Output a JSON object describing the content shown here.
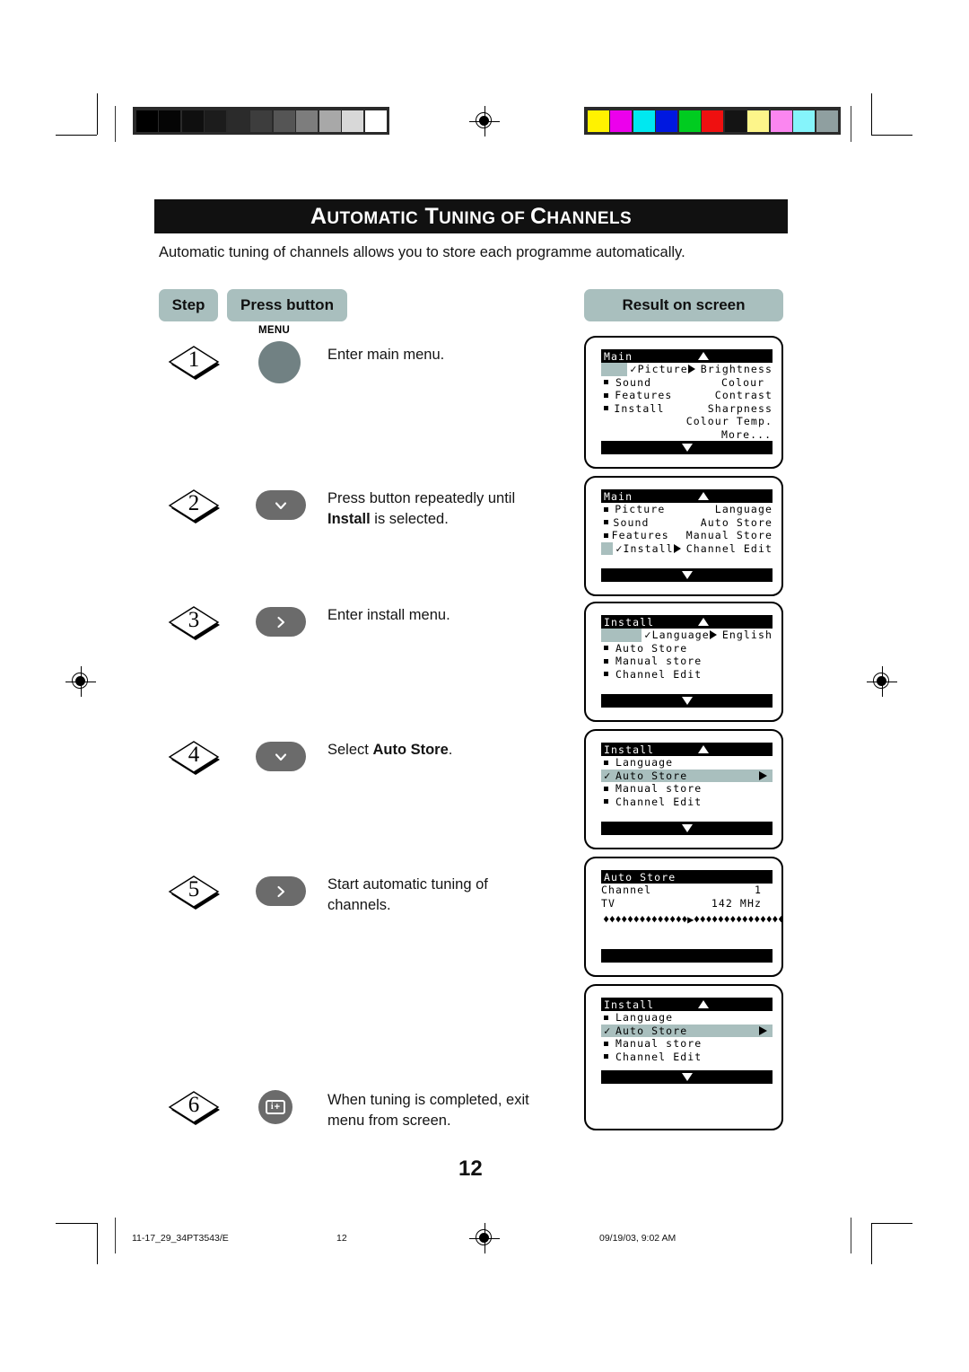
{
  "document": {
    "title_parts": [
      {
        "text": "A",
        "size": "big"
      },
      {
        "text": "UTOMATIC",
        "size": "small"
      },
      {
        "text": " T",
        "size": "big"
      },
      {
        "text": "UNING",
        "size": "small"
      },
      {
        "text": " OF ",
        "size": "small"
      },
      {
        "text": "C",
        "size": "big"
      },
      {
        "text": "HANNELS",
        "size": "small"
      }
    ],
    "title_plain": "AUTOMATIC TUNING OF CHANNELS",
    "intro": "Automatic tuning of channels allows you to store each programme automatically.",
    "page_number": "12"
  },
  "headers": {
    "step": "Step",
    "press_button": "Press button",
    "result": "Result on screen"
  },
  "steps": [
    {
      "number": "1",
      "button": {
        "type": "circle",
        "icon": "menu-button",
        "label_above": "MENU",
        "color": "#718183",
        "glyph": ""
      },
      "text_plain": "Enter main menu.",
      "text_parts": [
        {
          "text": "Enter main menu.",
          "bold": false
        }
      ]
    },
    {
      "number": "2",
      "button": {
        "type": "round",
        "icon": "chevron-down-icon",
        "label_above": "",
        "color": "#6b6b6b",
        "glyph": "⌄"
      },
      "text_plain": "Press button repeatedly until Install is selected.",
      "text_parts": [
        {
          "text": "Press button repeatedly until ",
          "bold": false
        },
        {
          "text": "Install",
          "bold": true
        },
        {
          "text": " is selected.",
          "bold": false
        }
      ]
    },
    {
      "number": "3",
      "button": {
        "type": "round",
        "icon": "chevron-right-icon",
        "label_above": "",
        "color": "#6b6b6b",
        "glyph": "›"
      },
      "text_plain": "Enter install menu.",
      "text_parts": [
        {
          "text": "Enter install menu.",
          "bold": false
        }
      ]
    },
    {
      "number": "4",
      "button": {
        "type": "round",
        "icon": "chevron-down-icon",
        "label_above": "",
        "color": "#6b6b6b",
        "glyph": "⌄"
      },
      "text_plain": "Select Auto Store.",
      "text_parts": [
        {
          "text": "Select ",
          "bold": false
        },
        {
          "text": "Auto Store",
          "bold": true
        },
        {
          "text": ".",
          "bold": false
        }
      ]
    },
    {
      "number": "5",
      "button": {
        "type": "round",
        "icon": "chevron-right-icon",
        "label_above": "",
        "color": "#6b6b6b",
        "glyph": "›"
      },
      "text_plain": "Start automatic tuning of channels.",
      "text_parts": [
        {
          "text": "Start automatic tuning of channels.",
          "bold": false
        }
      ]
    },
    {
      "number": "6",
      "button": {
        "type": "circle-small",
        "icon": "exit-screen-icon",
        "label_above": "",
        "color": "#6b6b6b",
        "glyph": ""
      },
      "text_plain": "When tuning is completed, exit menu from screen.",
      "text_parts": [
        {
          "text": "When tuning is completed, exit menu from screen.",
          "bold": false
        }
      ]
    }
  ],
  "osd_panels": [
    {
      "title": "Main",
      "has_up_arrow": true,
      "has_bottom_bar": true,
      "bottom_bar_arrow": true,
      "rows": [
        {
          "mark": "check",
          "label": "Picture",
          "arrow": true,
          "right": "Brightness",
          "highlight": "narrow"
        },
        {
          "mark": "square",
          "label": "Sound",
          "arrow": false,
          "right": "Colour",
          "highlight": "none"
        },
        {
          "mark": "square",
          "label": "Features",
          "arrow": false,
          "right": "Contrast",
          "highlight": "none"
        },
        {
          "mark": "square",
          "label": "Install",
          "arrow": false,
          "right": "Sharpness",
          "highlight": "none"
        },
        {
          "mark": "none",
          "label": "",
          "arrow": false,
          "right": "Colour Temp.",
          "highlight": "none"
        },
        {
          "mark": "none",
          "label": "",
          "arrow": false,
          "right": "More...",
          "highlight": "none"
        }
      ]
    },
    {
      "title": "Main",
      "has_up_arrow": true,
      "has_bottom_bar": true,
      "bottom_bar_arrow": true,
      "rows": [
        {
          "mark": "square",
          "label": "Picture",
          "arrow": false,
          "right": "Language",
          "highlight": "none"
        },
        {
          "mark": "square",
          "label": "Sound",
          "arrow": false,
          "right": "Auto Store",
          "highlight": "none"
        },
        {
          "mark": "square",
          "label": "Features",
          "arrow": false,
          "right": "Manual Store",
          "highlight": "none"
        },
        {
          "mark": "check",
          "label": "Install",
          "arrow": true,
          "right": "Channel Edit",
          "highlight": "narrow"
        }
      ]
    },
    {
      "title": "Install",
      "has_up_arrow": true,
      "has_bottom_bar": true,
      "bottom_bar_arrow": true,
      "rows": [
        {
          "mark": "check",
          "label": "Language",
          "arrow": true,
          "right": "English",
          "highlight": "narrow"
        },
        {
          "mark": "square",
          "label": "Auto Store",
          "arrow": false,
          "right": "",
          "highlight": "none"
        },
        {
          "mark": "square",
          "label": "Manual store",
          "arrow": false,
          "right": "",
          "highlight": "none"
        },
        {
          "mark": "square",
          "label": "Channel Edit",
          "arrow": false,
          "right": "",
          "highlight": "none"
        }
      ]
    },
    {
      "title": "Install",
      "has_up_arrow": true,
      "has_bottom_bar": true,
      "bottom_bar_arrow": true,
      "rows": [
        {
          "mark": "square",
          "label": "Language",
          "arrow": false,
          "right": "",
          "highlight": "none"
        },
        {
          "mark": "check",
          "label": "Auto Store",
          "arrow": false,
          "right": "",
          "highlight": "full"
        },
        {
          "mark": "square",
          "label": "Manual store",
          "arrow": false,
          "right": "",
          "highlight": "none"
        },
        {
          "mark": "square",
          "label": "Channel Edit",
          "arrow": false,
          "right": "",
          "highlight": "none"
        }
      ]
    },
    {
      "title": "Auto Store",
      "has_up_arrow": false,
      "has_bottom_bar": true,
      "bottom_bar_arrow": false,
      "value_rows": [
        {
          "mark": "square",
          "label": "Channel",
          "value": "1"
        },
        {
          "mark": "square",
          "label": "TV",
          "value": "142 MHz"
        }
      ],
      "progress": {
        "left_diamonds": 14,
        "right_diamonds": 17,
        "marker": "▶"
      }
    },
    {
      "title": "Install",
      "has_up_arrow": true,
      "has_bottom_bar": true,
      "bottom_bar_arrow": true,
      "rows": [
        {
          "mark": "square",
          "label": "Language",
          "arrow": false,
          "right": "",
          "highlight": "none"
        },
        {
          "mark": "check",
          "label": "Auto Store",
          "arrow": false,
          "right": "",
          "highlight": "full"
        },
        {
          "mark": "square",
          "label": "Manual store",
          "arrow": false,
          "right": "",
          "highlight": "none"
        },
        {
          "mark": "square",
          "label": "Channel Edit",
          "arrow": false,
          "right": "",
          "highlight": "none"
        }
      ]
    }
  ],
  "calibration": {
    "grayscale": [
      "#000000",
      "#050505",
      "#0f0f0f",
      "#1c1c1c",
      "#2b2b2b",
      "#3d3d3d",
      "#555555",
      "#7d7d7d",
      "#a8a8a8",
      "#d8d8d8",
      "#ffffff"
    ],
    "colors": [
      "#fff200",
      "#ec00ec",
      "#00e8f0",
      "#0018e0",
      "#00cc20",
      "#ef1010",
      "#141414",
      "#fdf58a",
      "#fb86f0",
      "#85f4fb",
      "#8f9fa0"
    ]
  },
  "footer": {
    "job_id": "11-17_29_34PT3543/E",
    "page": "12",
    "timestamp": "09/19/03, 9:02 AM"
  }
}
